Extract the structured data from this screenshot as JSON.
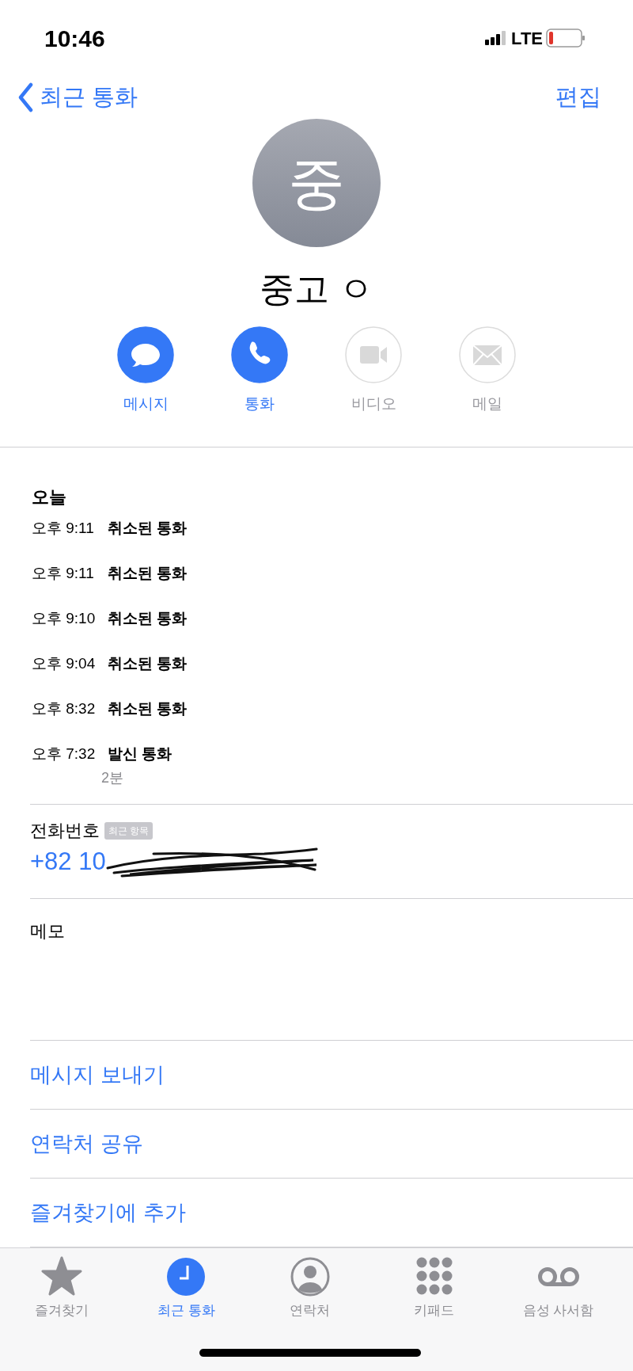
{
  "status_bar": {
    "time": "10:46",
    "network": "LTE"
  },
  "nav": {
    "back": "최근 통화",
    "edit": "편집"
  },
  "contact": {
    "initial": "중",
    "name": "중고 ㅇ"
  },
  "actions": [
    {
      "kind": "message",
      "label": "메시지",
      "disabled": false
    },
    {
      "kind": "call",
      "label": "통화",
      "disabled": false
    },
    {
      "kind": "video",
      "label": "비디오",
      "disabled": true
    },
    {
      "kind": "mail",
      "label": "메일",
      "disabled": true
    }
  ],
  "calls": {
    "heading": "오늘",
    "rows": [
      {
        "time": "오후 9:11",
        "type": "취소된 통화"
      },
      {
        "time": "오후 9:11",
        "type": "취소된 통화"
      },
      {
        "time": "오후 9:10",
        "type": "취소된 통화"
      },
      {
        "time": "오후 9:04",
        "type": "취소된 통화"
      },
      {
        "time": "오후 8:32",
        "type": "취소된 통화"
      },
      {
        "time": "오후 7:32",
        "type": "발신 통화",
        "duration": "2분"
      }
    ]
  },
  "phone": {
    "label": "전화번호",
    "badge": "최근 항목",
    "number": "+82 10"
  },
  "memo": {
    "label": "메모"
  },
  "links": [
    "메시지 보내기",
    "연락처 공유",
    "즐겨찾기에 추가"
  ],
  "tab_bar": [
    {
      "kind": "favorites",
      "label": "즐겨찾기",
      "selected": false
    },
    {
      "kind": "recents",
      "label": "최근 통화",
      "selected": true
    },
    {
      "kind": "contacts",
      "label": "연락처",
      "selected": false
    },
    {
      "kind": "keypad",
      "label": "키패드",
      "selected": false
    },
    {
      "kind": "voicemail",
      "label": "음성 사서함",
      "selected": false
    }
  ]
}
